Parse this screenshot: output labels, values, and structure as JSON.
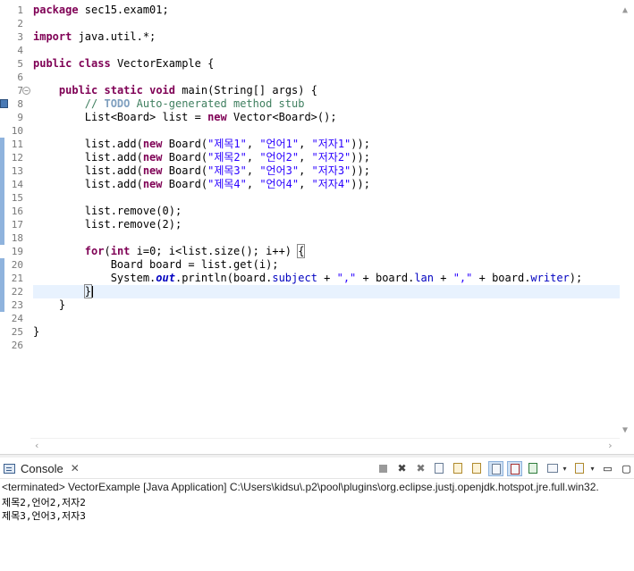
{
  "editor": {
    "line_numbers": [
      "1",
      "2",
      "3",
      "4",
      "5",
      "6",
      "7",
      "8",
      "9",
      "10",
      "11",
      "12",
      "13",
      "14",
      "15",
      "16",
      "17",
      "18",
      "19",
      "20",
      "21",
      "22",
      "23",
      "24",
      "25",
      "26"
    ],
    "code": [
      [
        {
          "t": "package",
          "c": "kw"
        },
        {
          "t": " sec15.exam01;"
        }
      ],
      [],
      [
        {
          "t": "import",
          "c": "kw"
        },
        {
          "t": " java.util.*;"
        }
      ],
      [],
      [
        {
          "t": "public",
          "c": "kw"
        },
        {
          "t": " "
        },
        {
          "t": "class",
          "c": "kw"
        },
        {
          "t": " VectorExample {"
        }
      ],
      [],
      [
        {
          "t": "    "
        },
        {
          "t": "public",
          "c": "kw"
        },
        {
          "t": " "
        },
        {
          "t": "static",
          "c": "kw"
        },
        {
          "t": " "
        },
        {
          "t": "void",
          "c": "kw"
        },
        {
          "t": " main(String[] args) {"
        }
      ],
      [
        {
          "t": "        // ",
          "c": "cm"
        },
        {
          "t": "TODO",
          "c": "todo"
        },
        {
          "t": " Auto-generated method stub",
          "c": "cm"
        }
      ],
      [
        {
          "t": "        List<Board> list = "
        },
        {
          "t": "new",
          "c": "kw"
        },
        {
          "t": " Vector<Board>();"
        }
      ],
      [],
      [
        {
          "t": "        list.add("
        },
        {
          "t": "new",
          "c": "kw"
        },
        {
          "t": " Board("
        },
        {
          "t": "\"제목1\"",
          "c": "st"
        },
        {
          "t": ", "
        },
        {
          "t": "\"언어1\"",
          "c": "st"
        },
        {
          "t": ", "
        },
        {
          "t": "\"저자1\"",
          "c": "st"
        },
        {
          "t": "));"
        }
      ],
      [
        {
          "t": "        list.add("
        },
        {
          "t": "new",
          "c": "kw"
        },
        {
          "t": " Board("
        },
        {
          "t": "\"제목2\"",
          "c": "st"
        },
        {
          "t": ", "
        },
        {
          "t": "\"언어2\"",
          "c": "st"
        },
        {
          "t": ", "
        },
        {
          "t": "\"저자2\"",
          "c": "st"
        },
        {
          "t": "));"
        }
      ],
      [
        {
          "t": "        list.add("
        },
        {
          "t": "new",
          "c": "kw"
        },
        {
          "t": " Board("
        },
        {
          "t": "\"제목3\"",
          "c": "st"
        },
        {
          "t": ", "
        },
        {
          "t": "\"언어3\"",
          "c": "st"
        },
        {
          "t": ", "
        },
        {
          "t": "\"저자3\"",
          "c": "st"
        },
        {
          "t": "));"
        }
      ],
      [
        {
          "t": "        list.add("
        },
        {
          "t": "new",
          "c": "kw"
        },
        {
          "t": " Board("
        },
        {
          "t": "\"제목4\"",
          "c": "st"
        },
        {
          "t": ", "
        },
        {
          "t": "\"언어4\"",
          "c": "st"
        },
        {
          "t": ", "
        },
        {
          "t": "\"저자4\"",
          "c": "st"
        },
        {
          "t": "));"
        }
      ],
      [],
      [
        {
          "t": "        list.remove(0);"
        }
      ],
      [
        {
          "t": "        list.remove(2);"
        }
      ],
      [],
      [
        {
          "t": "        "
        },
        {
          "t": "for",
          "c": "kw"
        },
        {
          "t": "("
        },
        {
          "t": "int",
          "c": "kw"
        },
        {
          "t": " i=0; i<list.size(); i++) "
        },
        {
          "t": "{",
          "c": "brace-box"
        }
      ],
      [
        {
          "t": "            Board board = list.get(i);"
        }
      ],
      [
        {
          "t": "            System."
        },
        {
          "t": "out",
          "c": "sf"
        },
        {
          "t": ".println(board."
        },
        {
          "t": "subject",
          "c": "fi"
        },
        {
          "t": " + "
        },
        {
          "t": "\",\"",
          "c": "st"
        },
        {
          "t": " + board."
        },
        {
          "t": "lan",
          "c": "fi"
        },
        {
          "t": " + "
        },
        {
          "t": "\",\"",
          "c": "st"
        },
        {
          "t": " + board."
        },
        {
          "t": "writer",
          "c": "fi"
        },
        {
          "t": ");"
        }
      ],
      [
        {
          "t": "        "
        },
        {
          "t": "}",
          "c": "brace-box"
        },
        {
          "t": "",
          "c": "caret"
        }
      ],
      [
        {
          "t": "    }"
        }
      ],
      [],
      [
        {
          "t": "}"
        }
      ],
      []
    ]
  },
  "console": {
    "tab_label": "Console",
    "header": "<terminated> VectorExample [Java Application] C:\\Users\\kidsu\\.p2\\pool\\plugins\\org.eclipse.justj.openjdk.hotspot.jre.full.win32.",
    "output": [
      "제목2,언어2,저자2",
      "제목3,언어3,저자3"
    ]
  },
  "icons": {
    "vscroll_up": "▲",
    "hscroll_left": "‹",
    "hscroll_right": "›",
    "tab_close": "✕",
    "fold_minus": "−",
    "terminate": "■",
    "remove_launch": "✖",
    "remove_all": "✖",
    "minimize": "▭",
    "maximize": "▢"
  },
  "colors": {
    "keyword": "#7f0055",
    "comment": "#3f7f5f",
    "string": "#2a00ff",
    "field": "#0000c0",
    "current_line": "#e8f2fe",
    "ruler": "#8fb3dd"
  }
}
